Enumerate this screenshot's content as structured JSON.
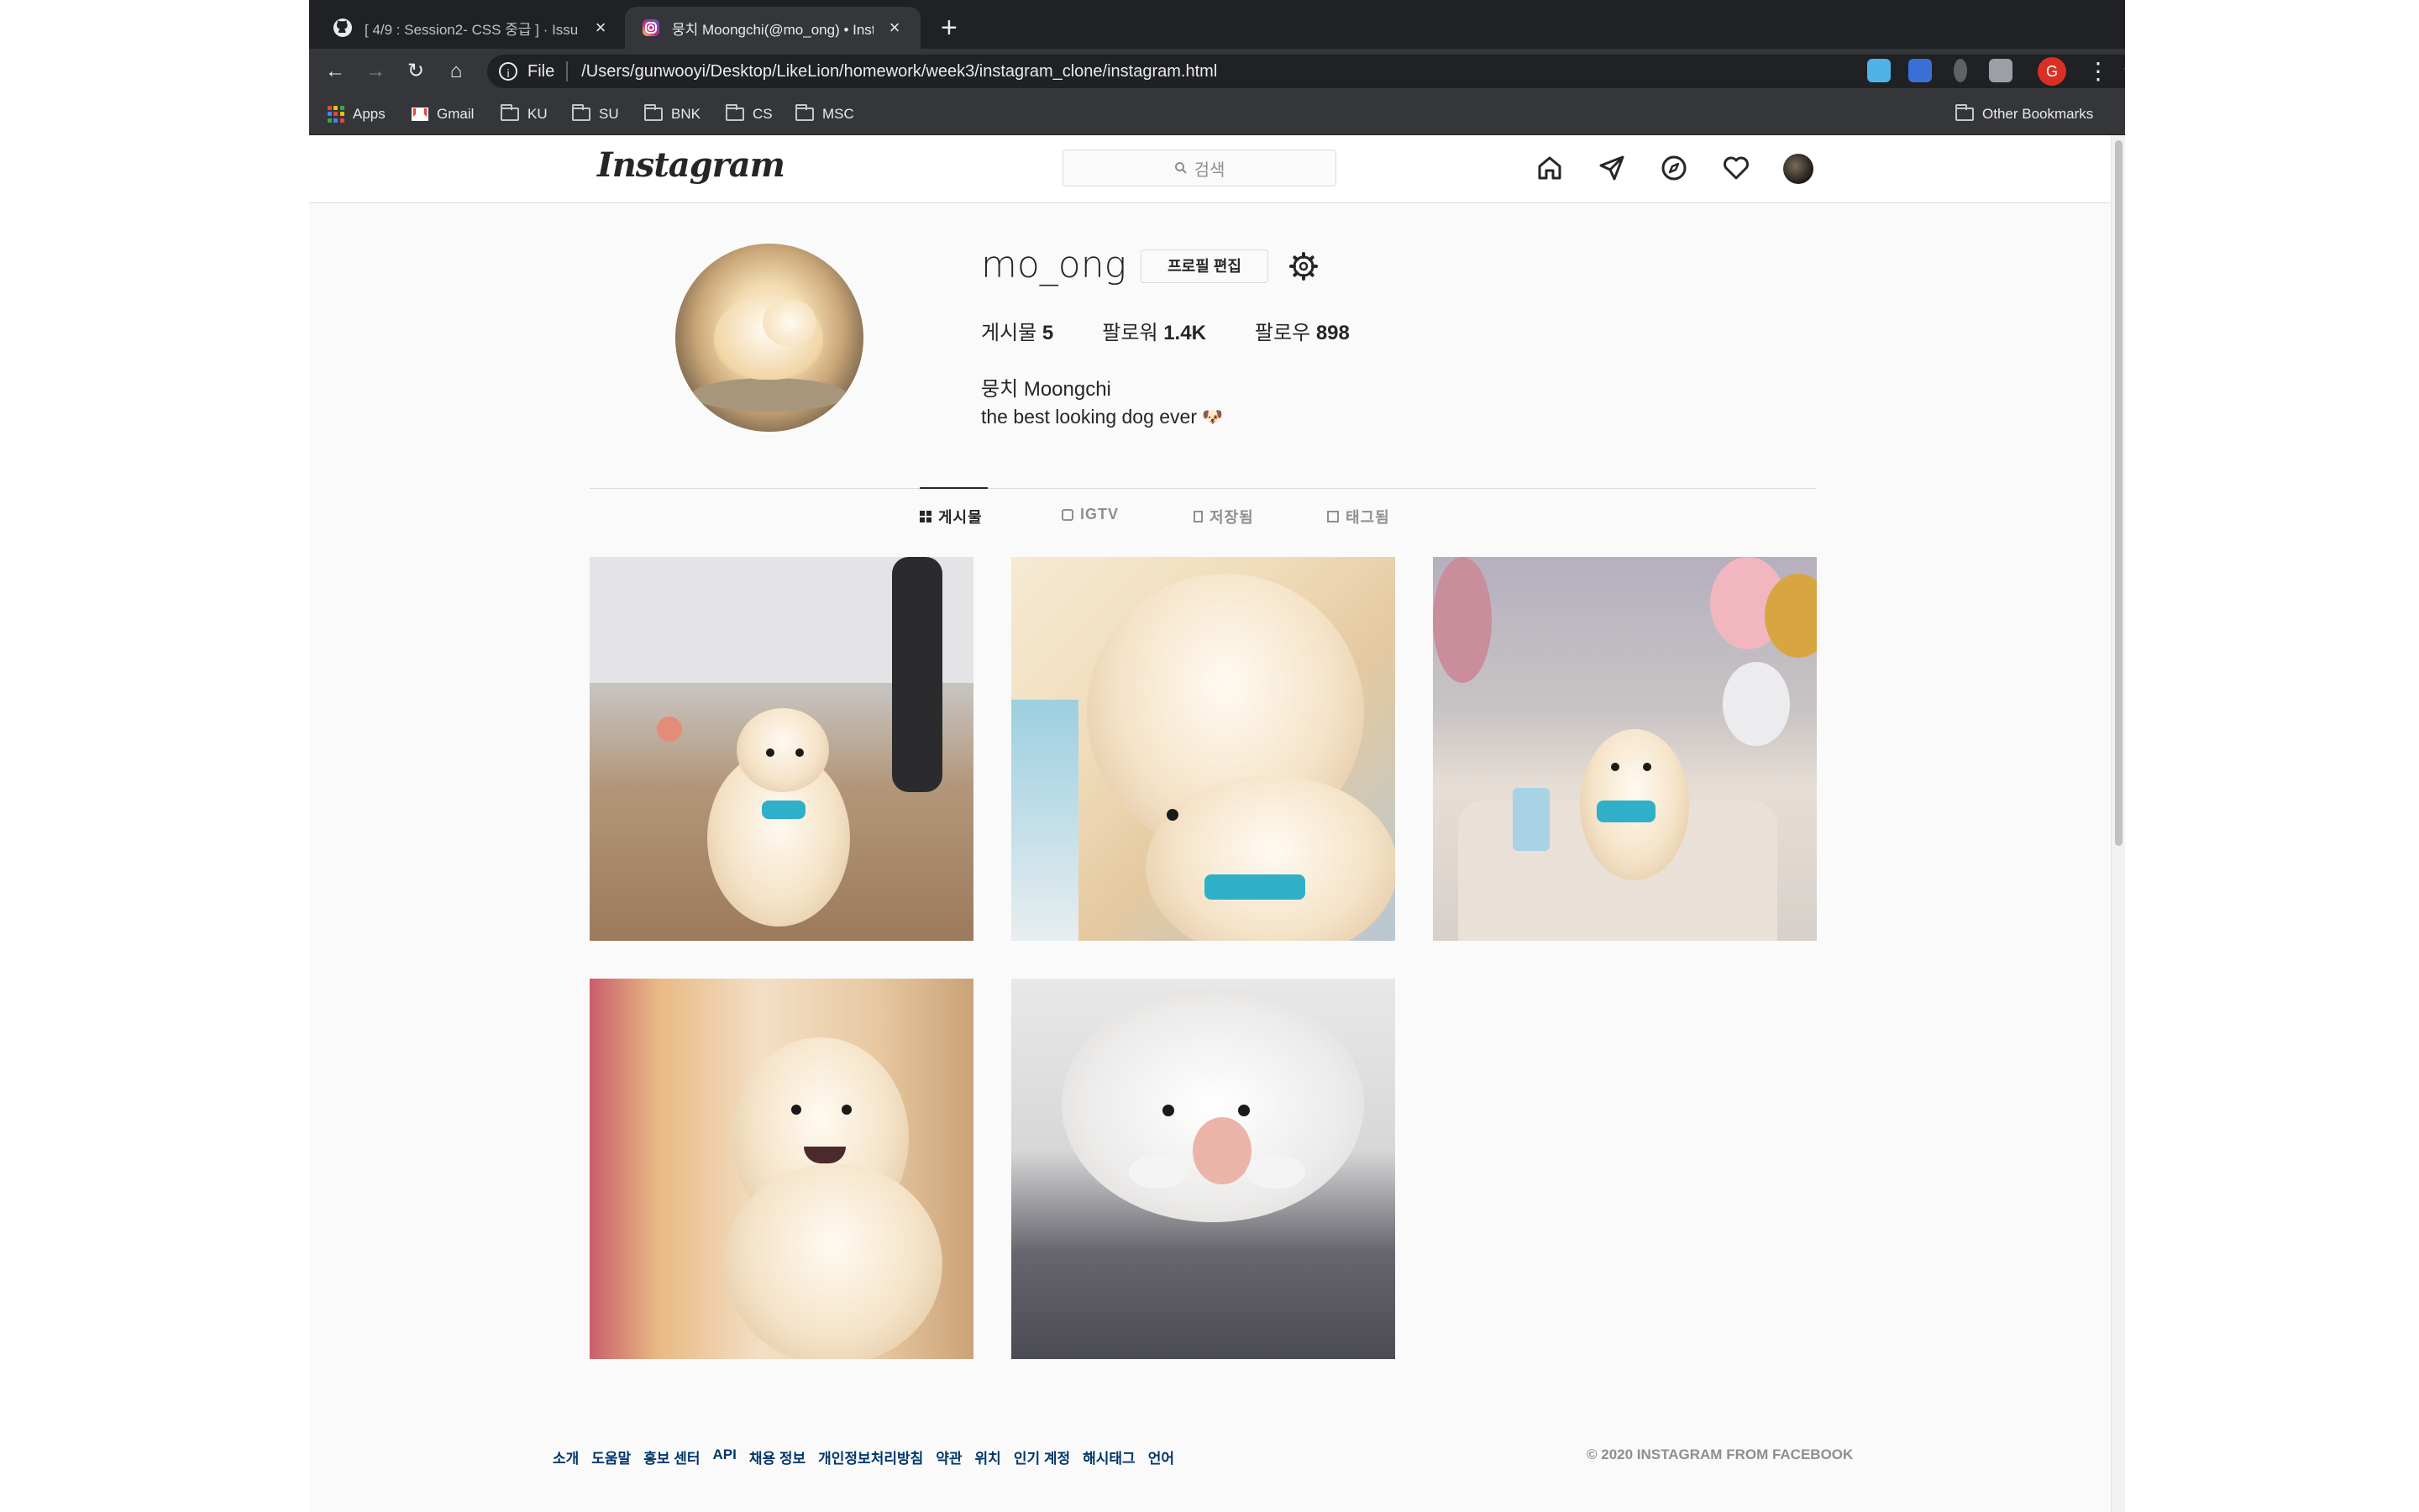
{
  "browser": {
    "tabs": [
      {
        "title": "[ 4/9 : Session2- CSS 중급 ] · Issu",
        "icon": "github-icon",
        "active": false
      },
      {
        "title": "뭉치 Moongchi(@mo_ong) • Insta",
        "icon": "instagram-icon",
        "active": true
      }
    ],
    "new_tab": "+",
    "address": {
      "scheme_label": "File",
      "url": "/Users/gunwooyi/Desktop/LikeLion/homework/week3/instagram_clone/instagram.html"
    },
    "profile_initial": "G",
    "bookmarks": [
      "Apps",
      "Gmail",
      "KU",
      "SU",
      "BNK",
      "CS",
      "MSC"
    ],
    "other_bookmarks": "Other Bookmarks"
  },
  "instagram": {
    "logo": "Instagram",
    "search_placeholder": "검색",
    "nav_icons": [
      "home-icon",
      "direct-icon",
      "explore-icon",
      "heart-icon",
      "profile-avatar"
    ],
    "profile": {
      "username": "mo_ong",
      "edit_button": "프로필 편집",
      "stats": [
        {
          "label": "게시물",
          "value": "5"
        },
        {
          "label": "팔로워",
          "value": "1.4K"
        },
        {
          "label": "팔로우",
          "value": "898"
        }
      ],
      "full_name": "뭉치 Moongchi",
      "bio": "the best looking dog ever",
      "bio_emoji": "🐶"
    },
    "tabs": [
      {
        "label": "게시물",
        "active": true
      },
      {
        "label": "IGTV",
        "active": false
      },
      {
        "label": "저장됨",
        "active": false
      },
      {
        "label": "태그됨",
        "active": false
      }
    ],
    "posts": 5,
    "footer": {
      "links": [
        "소개",
        "도움말",
        "홍보 센터",
        "API",
        "채용 정보",
        "개인정보처리방침",
        "약관",
        "위치",
        "인기 계정",
        "해시태그",
        "언어"
      ],
      "copyright": "© 2020 INSTAGRAM FROM FACEBOOK"
    }
  },
  "colors": {
    "chrome_dark": "#202124",
    "chrome_toolbar": "#35363a",
    "ig_background": "#fafafa",
    "ig_border": "#dbdbdb",
    "ig_text": "#262626",
    "ig_link": "#00376b",
    "ig_muted": "#8e8e8e"
  }
}
